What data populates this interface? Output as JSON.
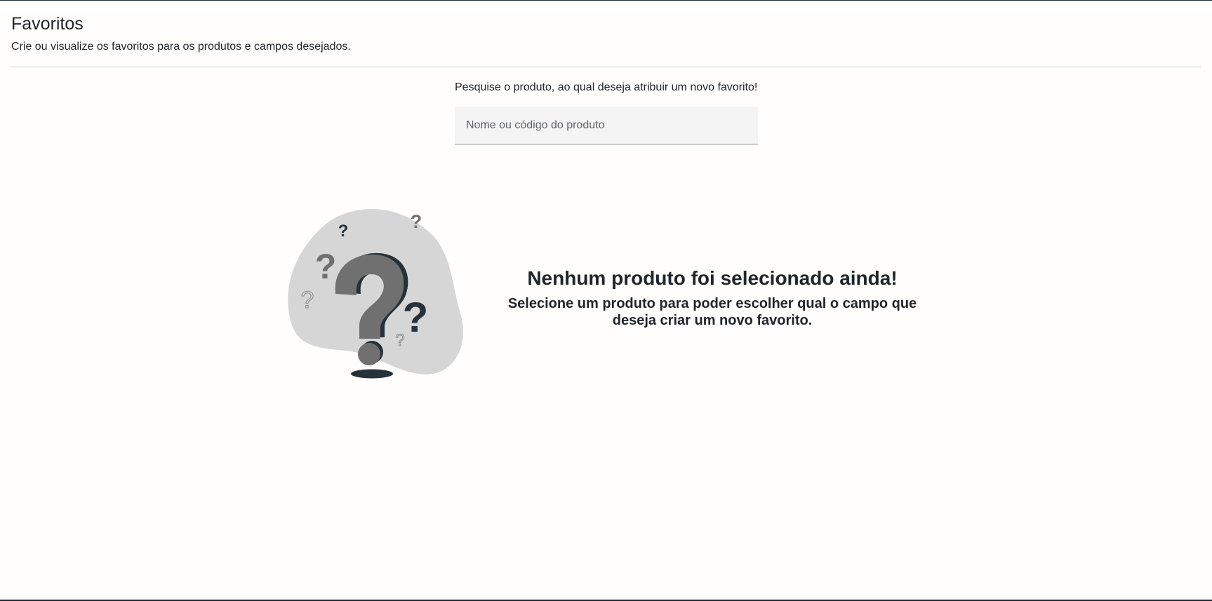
{
  "header": {
    "title": "Favoritos",
    "subtitle": "Crie ou visualize os favoritos para os produtos e campos desejados."
  },
  "search": {
    "prompt": "Pesquise o produto, ao qual deseja atribuir um novo favorito!",
    "placeholder": "Nome ou código do produto",
    "value": ""
  },
  "empty_state": {
    "illustration": "question-marks-illustration",
    "title": "Nenhum produto foi selecionado ainda!",
    "description": "Selecione um produto para poder escolher qual o campo que deseja criar um novo favorito."
  },
  "colors": {
    "blob": "#d6d6d6",
    "question_dark": "#263238",
    "question_grey": "#707070",
    "text": "#212529"
  }
}
